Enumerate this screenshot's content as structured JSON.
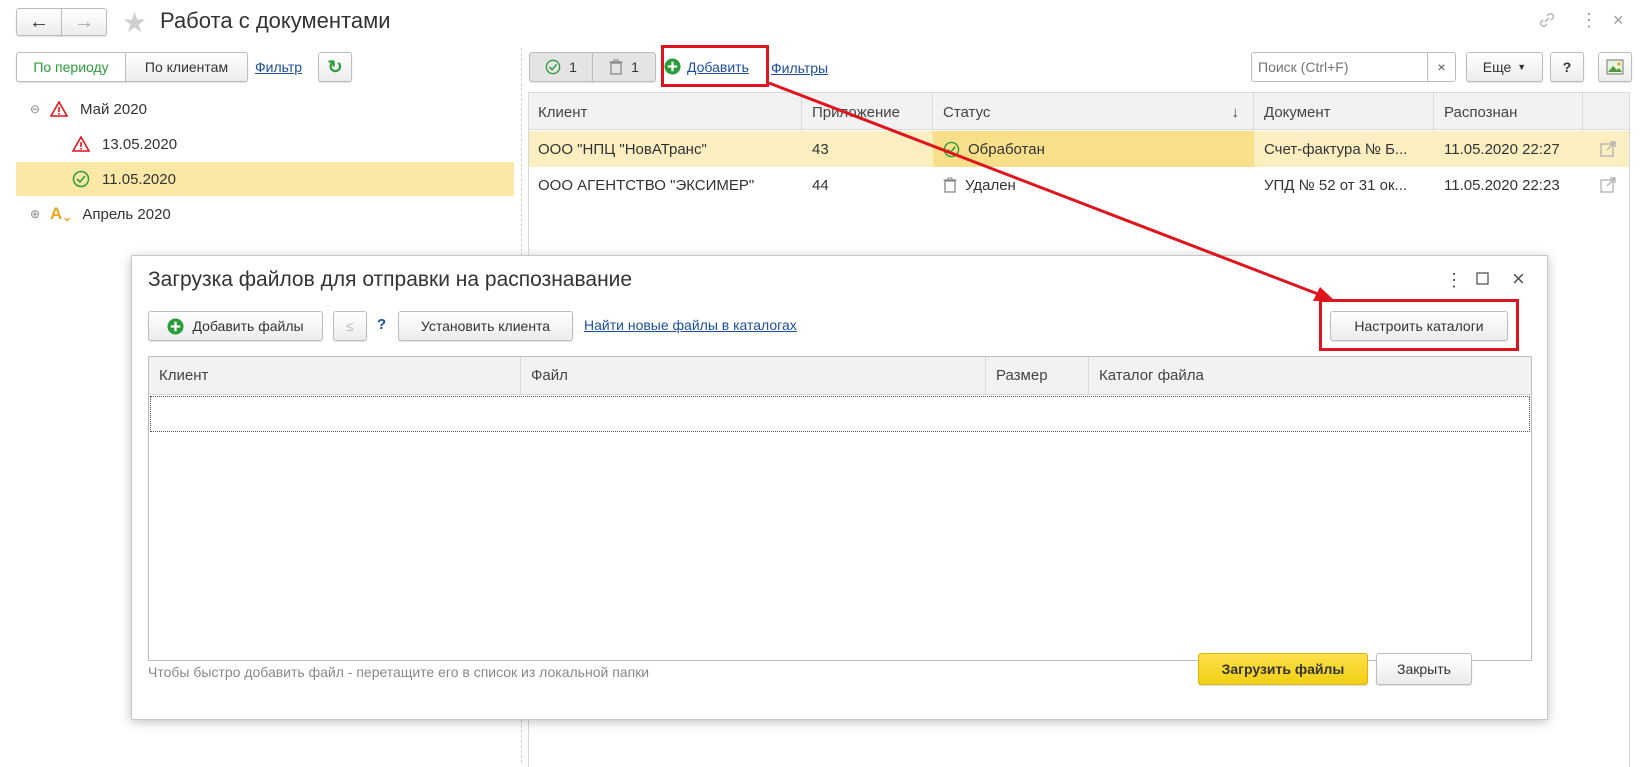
{
  "window": {
    "title": "Работа с документами"
  },
  "left_panel": {
    "btn_period": "По периоду",
    "btn_clients": "По клиентам",
    "filter_link": "Фильтр",
    "tree": [
      {
        "label": "Май 2020",
        "icon": "warning-icon"
      },
      {
        "label": "13.05.2020",
        "icon": "warning-icon"
      },
      {
        "label": "11.05.2020",
        "icon": "check-circle-icon"
      },
      {
        "label": "Апрель 2020",
        "icon": "pending-icon"
      }
    ]
  },
  "toolbar": {
    "processed_count": "1",
    "deleted_count": "1",
    "add_label": "Добавить",
    "filters_label": "Фильтры",
    "search_placeholder": "Поиск (Ctrl+F)",
    "clear_label": "×",
    "more_label": "Еще",
    "help_label": "?"
  },
  "grid": {
    "columns": [
      "Клиент",
      "Приложение",
      "Статус",
      "Документ",
      "Распознан"
    ],
    "sort_indicator": "↓",
    "rows": [
      {
        "client": "ООО \"НПЦ \"НовАТранс\"",
        "app": "43",
        "status": "Обработан",
        "document": "Счет-фактура № Б...",
        "recognized": "11.05.2020 22:27"
      },
      {
        "client": "ООО АГЕНТСТВО \"ЭКСИМЕР\"",
        "app": "44",
        "status": "Удален",
        "document": "УПД № 52 от 31 ок...",
        "recognized": "11.05.2020 22:23"
      }
    ]
  },
  "dialog": {
    "title": "Загрузка файлов для отправки на распознавание",
    "add_files": "Добавить файлы",
    "help": "?",
    "set_client": "Установить клиента",
    "find_new_link": "Найти новые файлы в каталогах",
    "setup_catalogs": "Настроить каталоги",
    "columns": [
      "Клиент",
      "Файл",
      "Размер",
      "Каталог файла"
    ],
    "hint": "Чтобы быстро добавить файл - перетащите его в список из локальной папки",
    "upload": "Загрузить файлы",
    "close": "Закрыть"
  },
  "colors": {
    "accent_yellow": "#f7d51d",
    "selection": "#fbe8a6",
    "link": "#1c4e9e",
    "highlight_red": "#e0141e",
    "green": "#2a9d3a"
  }
}
